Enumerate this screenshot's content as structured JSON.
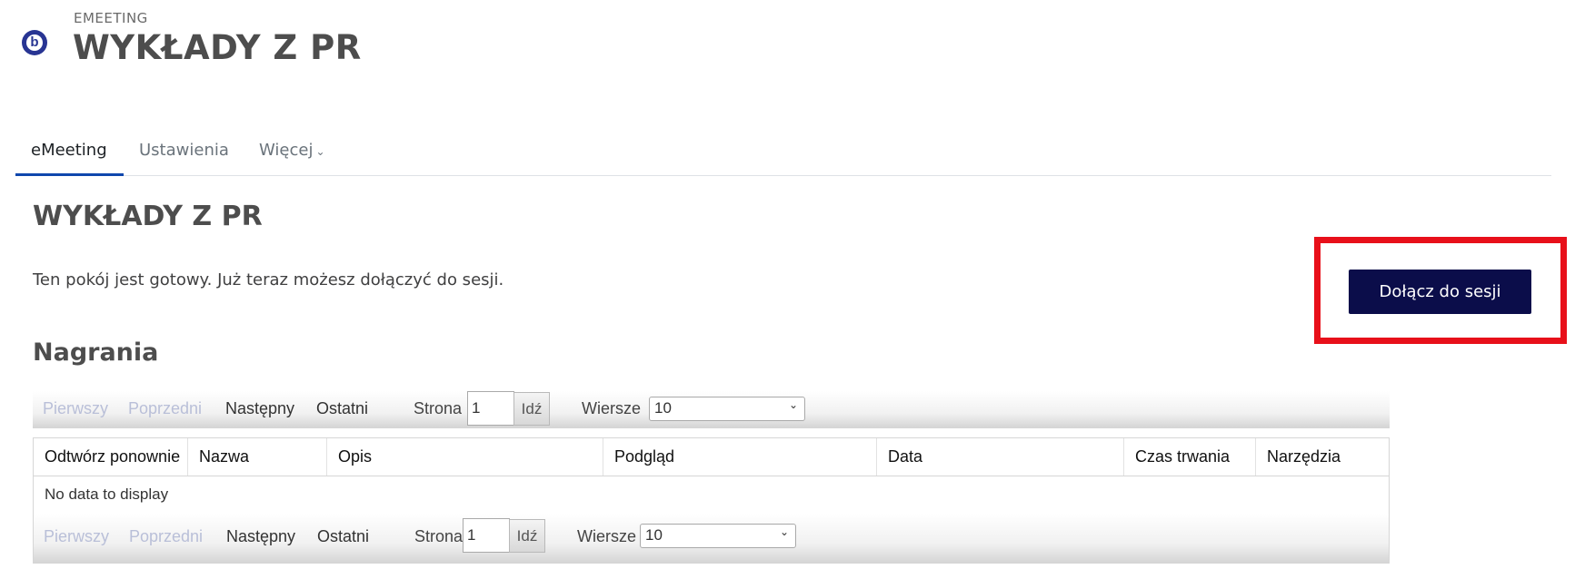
{
  "header": {
    "pretitle": "EMEETING",
    "title": "WYKŁADY Z PR",
    "logo_icon": "bigbluebutton-icon",
    "logo_letter": "b"
  },
  "tabs": [
    {
      "label": "eMeeting",
      "active": true
    },
    {
      "label": "Ustawienia",
      "active": false
    },
    {
      "label": "Więcej",
      "active": false
    }
  ],
  "room": {
    "title": "WYKŁADY Z PR",
    "status": "Ten pokój jest gotowy. Już teraz możesz dołączyć do sesji.",
    "join_label": "Dołącz do sesji"
  },
  "recordings": {
    "title": "Nagrania",
    "pager": {
      "first": "Pierwszy",
      "prev": "Poprzedni",
      "next": "Następny",
      "last": "Ostatni",
      "page_label": "Strona",
      "page_value": "1",
      "go": "Idź",
      "rows_label": "Wiersze",
      "rows_value": "10"
    },
    "columns": [
      "Odtwórz ponownie",
      "Nazwa",
      "Opis",
      "Podgląd",
      "Data",
      "Czas trwania",
      "Narzędzia"
    ],
    "empty": "No data to display"
  },
  "colors": {
    "join_button": "#0b0d4a",
    "highlight": "#e8101a",
    "tab_underline": "#0f47ad"
  }
}
